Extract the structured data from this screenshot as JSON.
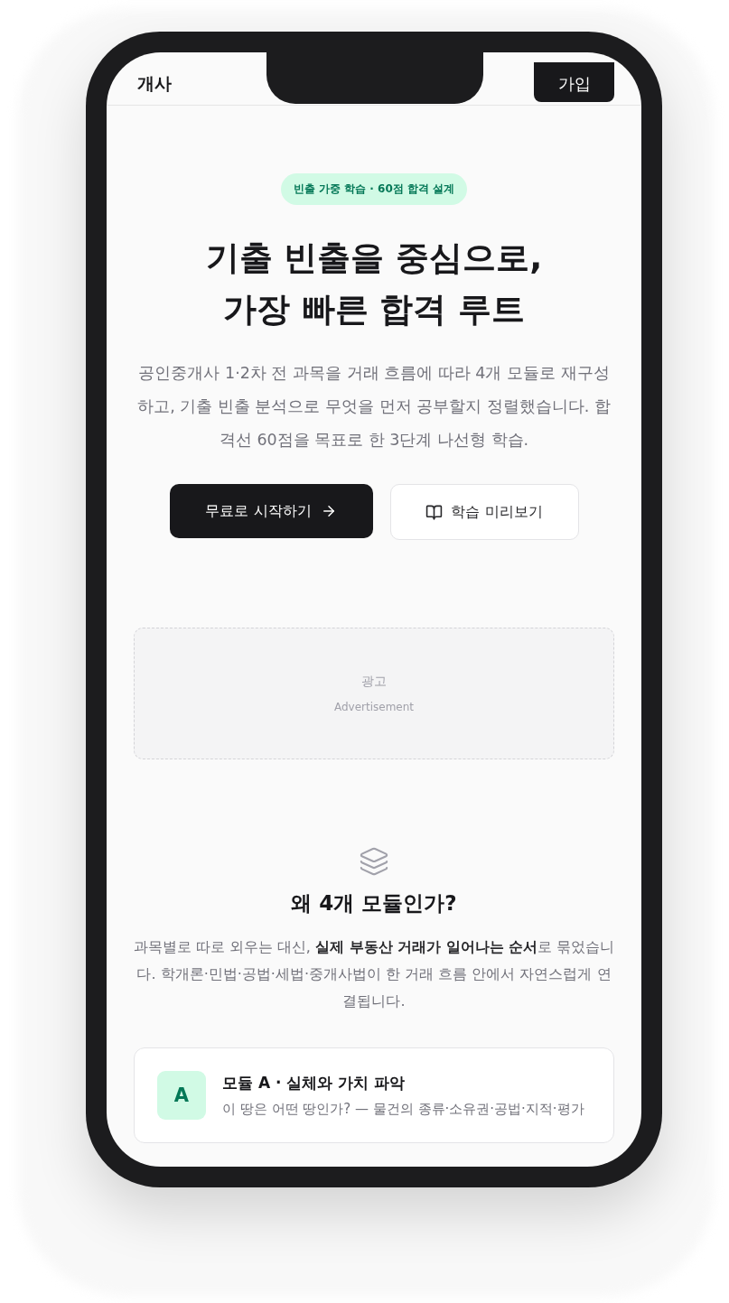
{
  "header": {
    "logo": "개사",
    "signup_button": "가입"
  },
  "hero": {
    "badge": "빈출 가중 학습 · 60점 합격 설계",
    "title_lines": [
      "기출 빈출을 중심으로,",
      "가장 빠른 합격 루트"
    ],
    "description": "공인중개사 1·2차 전 과목을 거래 흐름에 따라 4개 모듈로 재구성하고, 기출 빈출 분석으로 무엇을 먼저 공부할지 정렬했습니다. 합격선 60점을 목표로 한 3단계 나선형 학습.",
    "primary_button": "무료로 시작하기",
    "secondary_button": "학습 미리보기"
  },
  "ad": {
    "label": "광고",
    "caption": "Advertisement"
  },
  "why": {
    "title": "왜 4개 모듈인가?",
    "description": "과목별로 따로 외우는 대신, **실제 부동산 거래가 일어나는 순서**로 묶었습니다. 학개론·민법·공법·세법·중개사법이 한 거래 흐름 안에서 자연스럽게 연결됩니다."
  },
  "modules": [
    {
      "letter": "A",
      "title": "모듈 A · 실체와 가치 파악",
      "description": "이 땅은 어떤 땅인가? — 물건의 종류·소유권·공법·지적·평가"
    }
  ]
}
